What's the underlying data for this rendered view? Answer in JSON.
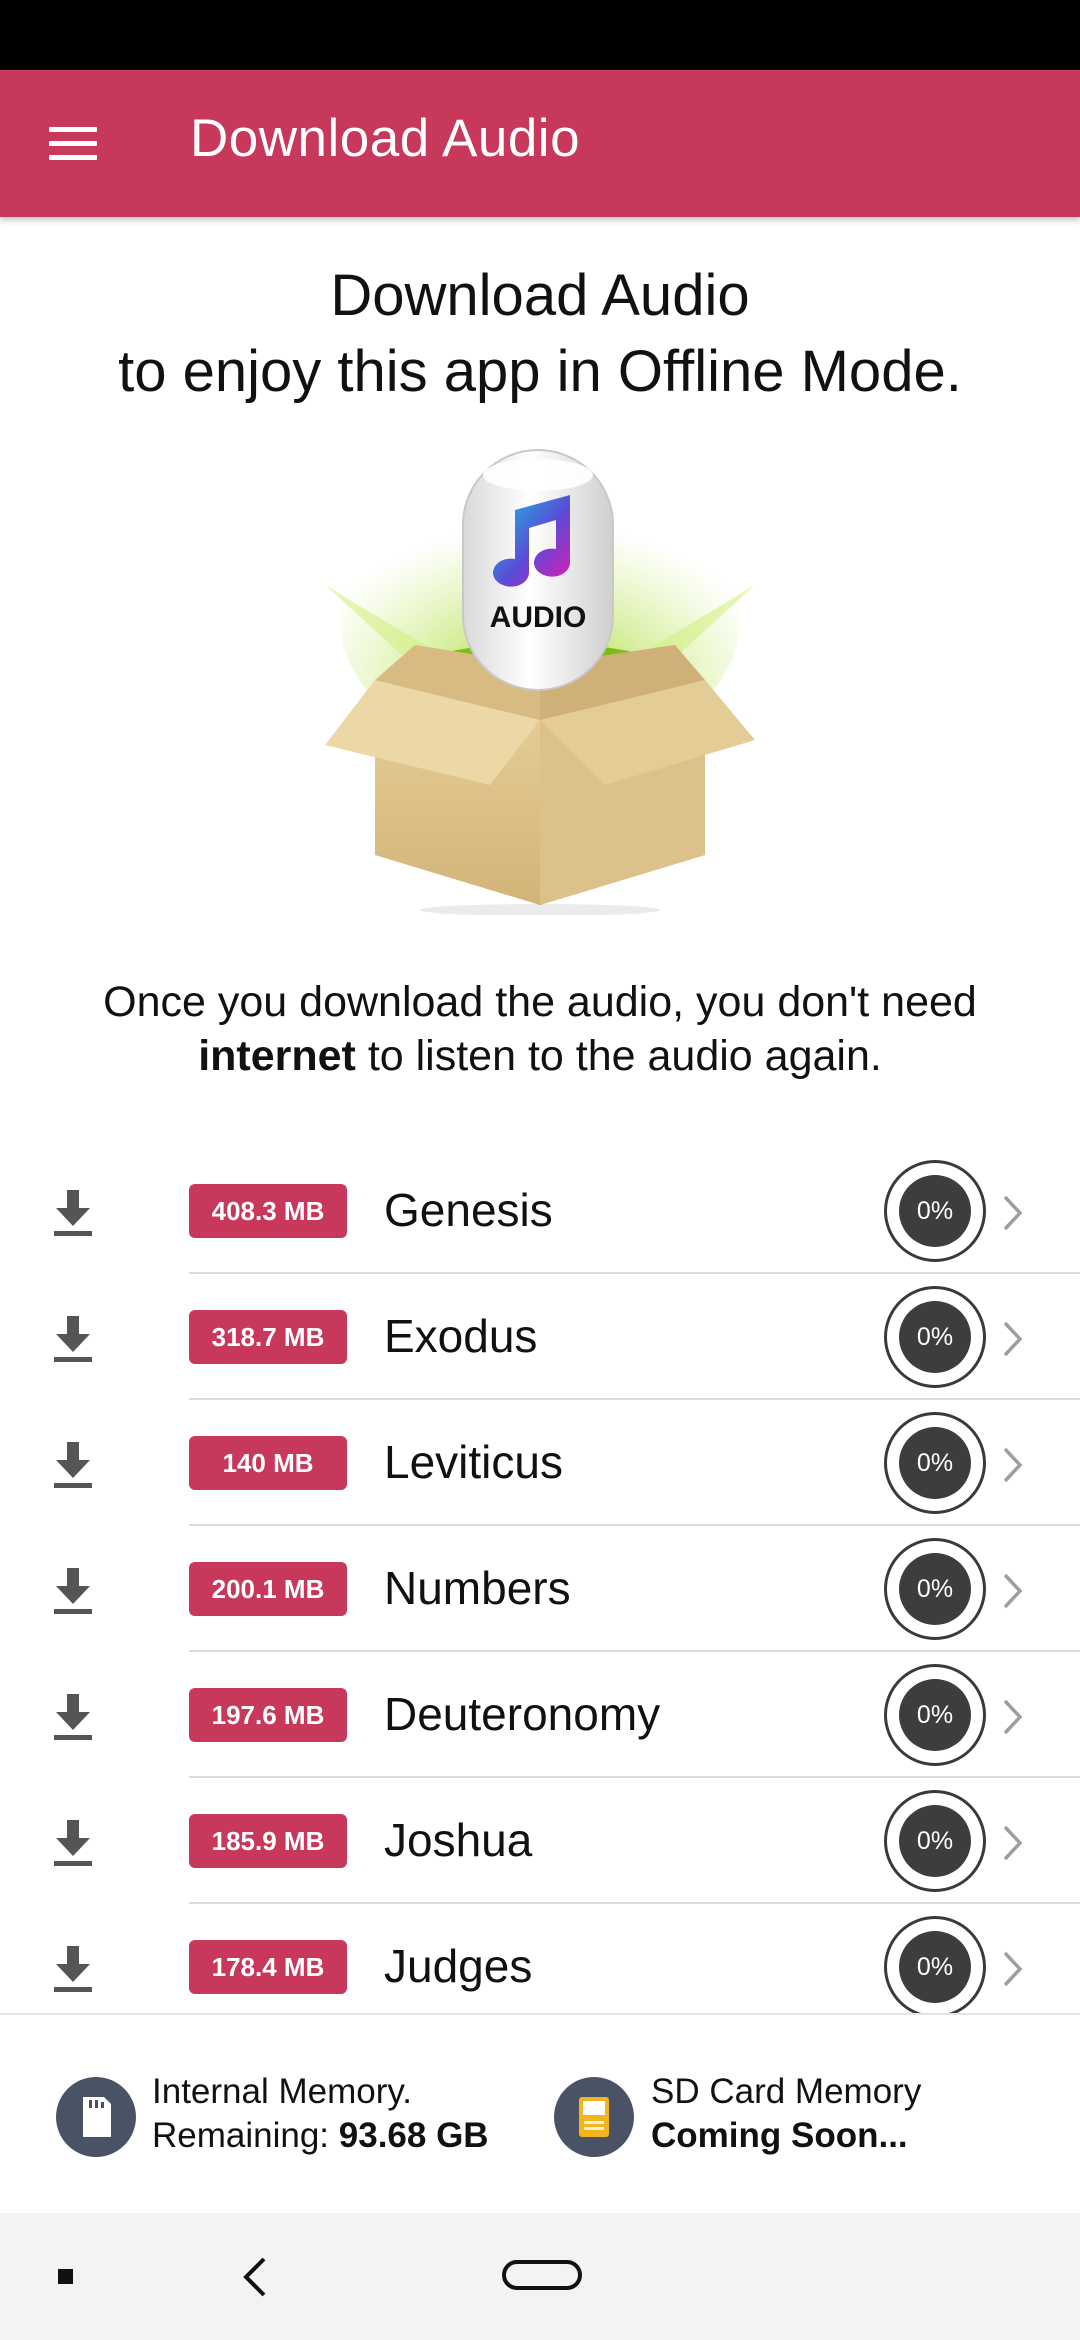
{
  "app_bar": {
    "title": "Download Audio",
    "menu_icon": "hamburger-menu-icon",
    "color": "#c8385a"
  },
  "headline": {
    "line1": "Download Audio",
    "line2": "to enjoy this app in Offline Mode."
  },
  "hero": {
    "label": "AUDIO",
    "icon": "music-note-icon"
  },
  "description": {
    "part1": "Once you download the audio, you don't need",
    "bold": "internet",
    "part2": " to listen to the audio again."
  },
  "books": [
    {
      "name": "Genesis",
      "size": "408.3 MB",
      "progress": "0%"
    },
    {
      "name": "Exodus",
      "size": "318.7 MB",
      "progress": "0%"
    },
    {
      "name": "Leviticus",
      "size": "140 MB",
      "progress": "0%"
    },
    {
      "name": "Numbers",
      "size": "200.1 MB",
      "progress": "0%"
    },
    {
      "name": "Deuteronomy",
      "size": "197.6 MB",
      "progress": "0%"
    },
    {
      "name": "Joshua",
      "size": "185.9 MB",
      "progress": "0%"
    },
    {
      "name": "Judges",
      "size": "178.4 MB",
      "progress": "0%"
    }
  ],
  "storage": {
    "internal": {
      "title": "Internal Memory.",
      "remaining_label": "Remaining: ",
      "remaining_value": "93.68 GB",
      "icon": "sd-card-icon"
    },
    "sd_card": {
      "title": "SD Card Memory",
      "status": "Coming Soon...",
      "icon": "sd-card-chip-icon"
    }
  },
  "system_nav": {
    "recents": "recents-square-icon",
    "back": "back-chevron-icon",
    "home": "home-pill-icon"
  }
}
